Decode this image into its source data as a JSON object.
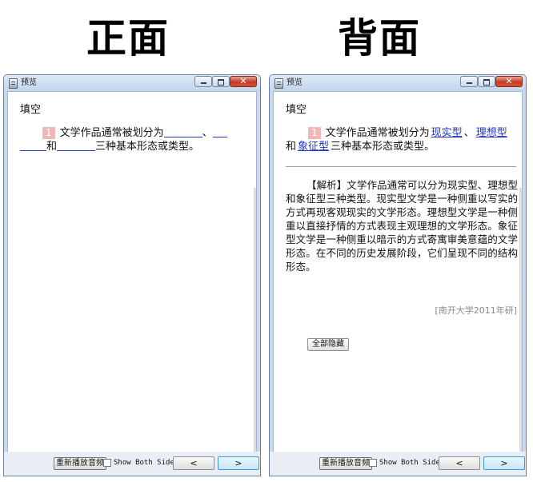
{
  "headings": {
    "front": "正面",
    "back": "背面"
  },
  "window": {
    "title": "预览",
    "close_glyph": "✕"
  },
  "card": {
    "section_title": "填空",
    "question_number": "1",
    "question_part1": "文学作品通常被划分为",
    "separator": "、",
    "conjunction": "和",
    "question_part2": "三种基本形态或类型。",
    "answers": {
      "first": "现实型",
      "second": "理想型",
      "third": "象征型"
    },
    "analysis": "【解析】文学作品通常可以分为现实型、理想型和象征型三种类型。现实型文学是一种侧重以写实的方式再现客观现实的文学形态。理想型文学是一种侧重以直接抒情的方式表现主观理想的文学形态。象征型文学是一种侧重以暗示的方式寄寓审美意蕴的文学形态。在不同的历史发展阶段，它们呈现不同的结构形态。",
    "source": "[南开大学2011年研]",
    "hide_all_label": "全部隐藏"
  },
  "toolbar": {
    "replay_label": "重新播放音频",
    "show_both_label": "Show Both Sides",
    "prev_glyph": "<",
    "next_glyph": ">"
  },
  "colors": {
    "answer": "#1f35c9",
    "badge": "#f1b6b6",
    "window_frame": "#c6d9ee",
    "close_button": "#c73b23"
  }
}
